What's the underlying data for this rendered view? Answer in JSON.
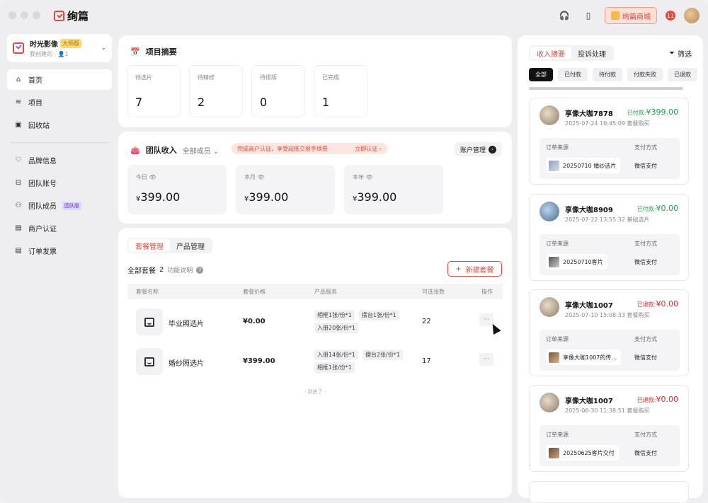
{
  "app": {
    "name": "绚篇"
  },
  "topbar": {
    "shop_label": "绚篇商城",
    "notify_count": "11"
  },
  "workspace": {
    "name": "时光影像",
    "badge": "大师版",
    "sub": "我创建的 · 👤1"
  },
  "nav": {
    "primary": [
      {
        "label": "首页",
        "icon": "home-icon",
        "glyph": "⌂"
      },
      {
        "label": "项目",
        "icon": "layers-icon",
        "glyph": "≋"
      },
      {
        "label": "回收站",
        "icon": "trash-icon",
        "glyph": "🗑"
      }
    ],
    "secondary": [
      {
        "label": "品牌信息",
        "icon": "brand-icon",
        "glyph": "♡"
      },
      {
        "label": "团队账号",
        "icon": "team-account-icon",
        "glyph": "⊟"
      },
      {
        "label": "团队成员",
        "icon": "team-members-icon",
        "glyph": "⚇",
        "badge": "团队版"
      },
      {
        "label": "商户认证",
        "icon": "merchant-icon",
        "glyph": "▤"
      },
      {
        "label": "订单发票",
        "icon": "invoice-icon",
        "glyph": "▤"
      }
    ]
  },
  "summary": {
    "title": "项目摘要",
    "stats": [
      {
        "label": "待选片",
        "value": "7"
      },
      {
        "label": "待精修",
        "value": "2"
      },
      {
        "label": "待排版",
        "value": "0"
      },
      {
        "label": "已完成",
        "value": "1"
      }
    ]
  },
  "income": {
    "title": "团队收入",
    "member_filter": "全部成员",
    "promo_text": "完成商户认证，享受超低交易手续费",
    "promo_link": "立即认证 ›",
    "account_btn": "账户管理",
    "cards": [
      {
        "label": "今日",
        "currency": "¥",
        "value": "399.00"
      },
      {
        "label": "本月",
        "currency": "¥",
        "value": "399.00"
      },
      {
        "label": "本年",
        "currency": "¥",
        "value": "399.00"
      }
    ]
  },
  "packages": {
    "tabs": [
      "套餐管理",
      "产品管理"
    ],
    "all_label": "全部套餐",
    "count": "2",
    "help": "功能说明",
    "new_btn": "新建套餐",
    "columns": [
      "套餐名称",
      "套餐价格",
      "产品服务",
      "可选张数",
      "操作"
    ],
    "rows": [
      {
        "name": "毕业照选片",
        "price": "¥0.00",
        "tags": [
          "相框1张/份*1",
          "摆台1张/份*1",
          "入册20张/份*1"
        ],
        "count": "22"
      },
      {
        "name": "婚纱照选片",
        "price": "¥399.00",
        "tags": [
          "入册14张/份*1",
          "摆台2张/份*1",
          "相框1张/份*1"
        ],
        "count": "17"
      }
    ],
    "end_text": "- 到底了 -"
  },
  "orders": {
    "tabs": [
      "收入摘要",
      "投诉处理"
    ],
    "filter_label": "筛选",
    "chips": [
      "全部",
      "已付款",
      "待付款",
      "付款失败",
      "已退款"
    ],
    "source_label": "订单来源",
    "pay_label": "支付方式",
    "items": [
      {
        "name": "享像大咖7878",
        "status": "已付款:",
        "amount": "¥399.00",
        "status_type": "paid",
        "meta": "2025-07-24 16:45:09 套餐购买",
        "source": "20250710 婚纱选片",
        "pay": "微信支付"
      },
      {
        "name": "享像大咖8909",
        "status": "已付款:",
        "amount": "¥0.00",
        "status_type": "paid",
        "meta": "2025-07-22 13:55:32 基础选片",
        "source": "20250710客片",
        "pay": "微信支付"
      },
      {
        "name": "享像大咖1007",
        "status": "已退款:",
        "amount": "¥0.00",
        "status_type": "refund",
        "meta": "2025-07-10 15:08:33 套餐购买",
        "source": "享像大咖1007的传...",
        "pay": "微信支付"
      },
      {
        "name": "享像大咖1007",
        "status": "已退款:",
        "amount": "¥0.00",
        "status_type": "refund",
        "meta": "2025-06-30 11:38:51 套餐购买",
        "source": "20250625客片交付",
        "pay": "微信支付"
      }
    ]
  }
}
